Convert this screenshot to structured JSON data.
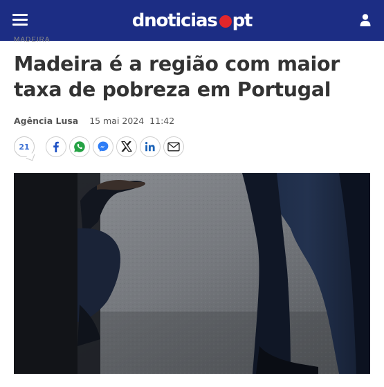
{
  "header": {
    "logo_main": "dnoticias",
    "logo_tld": "pt",
    "brand_color": "#1c2d84",
    "dot_color": "#e3262b"
  },
  "article": {
    "kicker": "MADEIRA",
    "title": "Madeira é a região com maior taxa de pobreza em Portugal",
    "author": "Agência Lusa",
    "date": "15 mai 2024",
    "time": "11:42",
    "comments_count": "21"
  },
  "share": {
    "icons": [
      "facebook-icon",
      "whatsapp-icon",
      "messenger-icon",
      "x-icon",
      "linkedin-icon",
      "email-icon"
    ]
  }
}
